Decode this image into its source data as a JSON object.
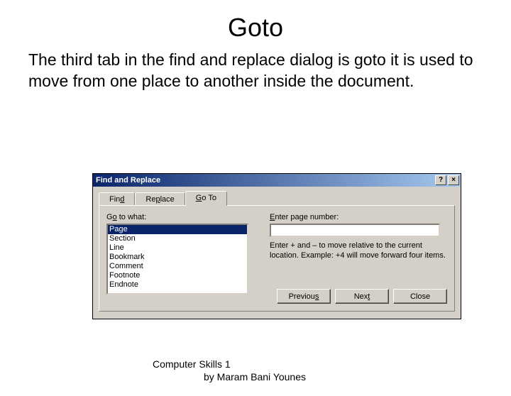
{
  "slide": {
    "title": "Goto",
    "body": "The third tab in the find and replace dialog is goto it is used to move from one place to another inside the document."
  },
  "dialog": {
    "title": "Find and Replace",
    "help_glyph": "?",
    "close_glyph": "×",
    "tabs": {
      "find": "Find",
      "replace": "Replace",
      "goto": "Go To"
    },
    "goto_label": "Go to what:",
    "list": {
      "page": "Page",
      "section": "Section",
      "line": "Line",
      "bookmark": "Bookmark",
      "comment": "Comment",
      "footnote": "Footnote",
      "endnote": "Endnote"
    },
    "enter_label": "Enter page number:",
    "enter_value": "",
    "hint": "Enter + and – to move relative to the current location. Example: +4 will move forward four items.",
    "buttons": {
      "previous": "Previous",
      "next": "Next",
      "close": "Close"
    }
  },
  "footer": {
    "line1": "Computer Skills 1",
    "line2": "by Maram Bani Younes"
  }
}
